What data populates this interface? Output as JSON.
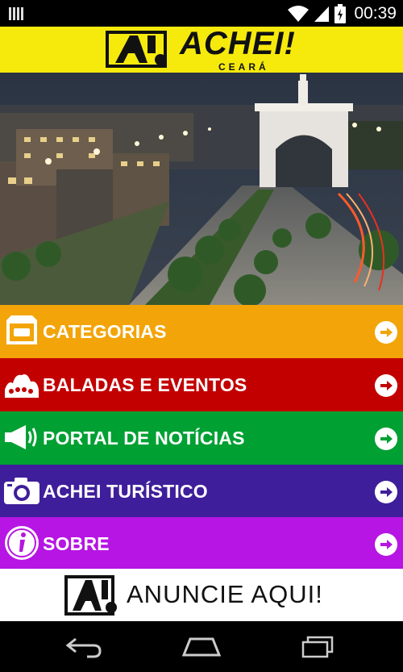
{
  "status_bar": {
    "time": "00:39",
    "icons": [
      "notification-icon",
      "wifi-icon",
      "signal-icon",
      "battery-icon"
    ]
  },
  "header": {
    "brand": "ACHEI!",
    "region": "CEARÁ",
    "background": "#f6ea0c"
  },
  "menu": {
    "items": [
      {
        "label": "CATEGORIAS",
        "icon": "drawer-icon",
        "color": "#f3a408"
      },
      {
        "label": "BALADAS E EVENTOS",
        "icon": "crowd-icon",
        "color": "#c20000"
      },
      {
        "label": "PORTAL DE NOTÍCIAS",
        "icon": "megaphone-icon",
        "color": "#00a033"
      },
      {
        "label": "ACHEI TURÍSTICO",
        "icon": "camera-icon",
        "color": "#3f1e9b"
      },
      {
        "label": "SOBRE",
        "icon": "info-icon",
        "color": "#b615e3"
      }
    ]
  },
  "banner": {
    "text": "ANUNCIE AQUI!"
  },
  "nav_bar": {
    "icons": [
      "back-icon",
      "home-icon",
      "recents-icon"
    ]
  }
}
